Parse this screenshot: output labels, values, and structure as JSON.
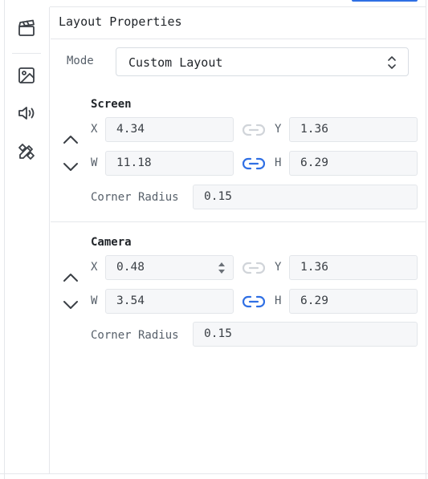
{
  "panel": {
    "title": "Layout Properties"
  },
  "mode": {
    "label": "Mode",
    "value": "Custom Layout"
  },
  "sidebar": {
    "icons": [
      "clapperboard-icon",
      "image-icon",
      "speaker-icon",
      "design-tools-icon"
    ]
  },
  "screen": {
    "title": "Screen",
    "x_label": "X",
    "x": "4.34",
    "y_label": "Y",
    "y": "1.36",
    "w_label": "W",
    "w": "11.18",
    "h_label": "H",
    "h": "6.29",
    "corner_label": "Corner Radius",
    "corner": "0.15"
  },
  "camera": {
    "title": "Camera",
    "x_label": "X",
    "x": "0.48",
    "y_label": "Y",
    "y": "1.36",
    "w_label": "W",
    "w": "3.54",
    "h_label": "H",
    "h": "6.29",
    "corner_label": "Corner Radius",
    "corner": "0.15"
  },
  "colors": {
    "accent": "#2f6fe4",
    "link_inactive": "#d0d4d9",
    "field_bg": "#f6f7f9"
  }
}
